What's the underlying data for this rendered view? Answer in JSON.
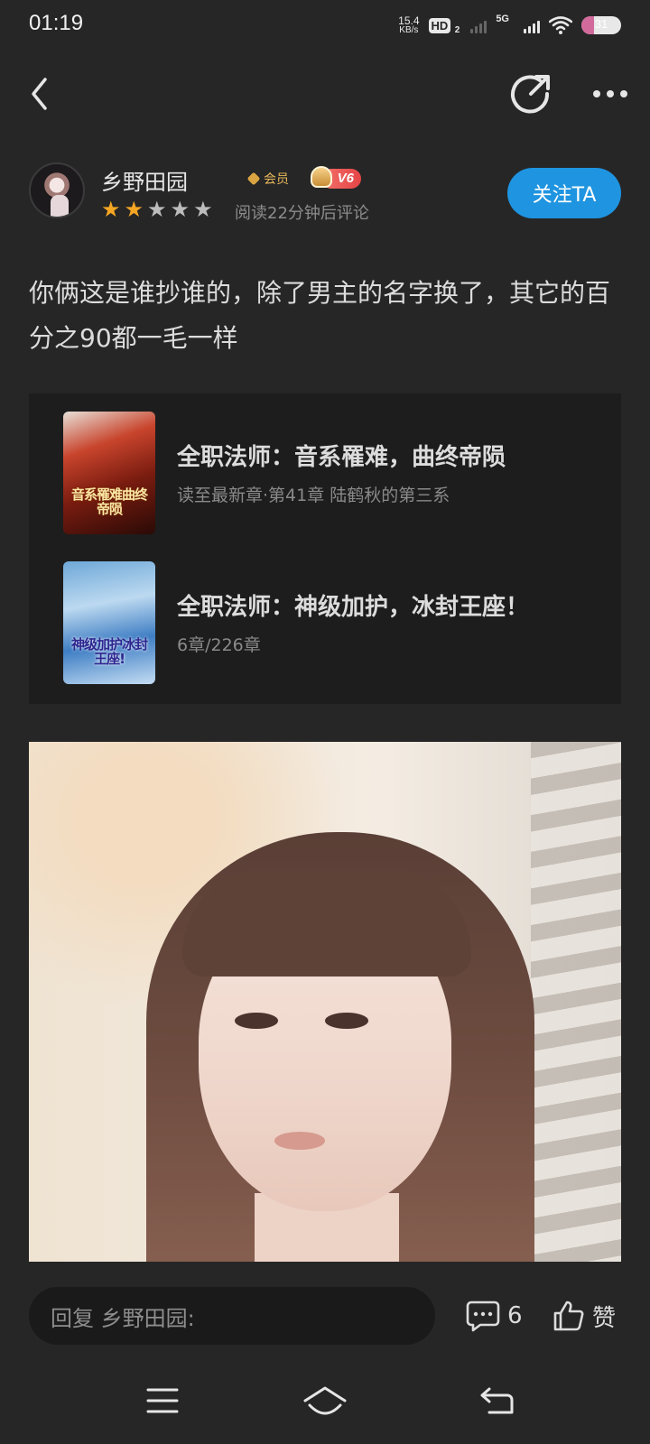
{
  "status_bar": {
    "time": "01:19",
    "net_speed_value": "15.4",
    "net_speed_unit": "KB/s",
    "hd_label": "HD",
    "hd_sub": "2",
    "network_type": "5G",
    "battery_level": "31"
  },
  "author": {
    "name": "乡野田园",
    "vip_label": "会员",
    "level": "V6",
    "rating": 2,
    "rating_max": 5,
    "rating_note": "阅读22分钟后评论",
    "follow_label": "关注TA"
  },
  "comment": {
    "text": "你俩这是谁抄谁的，除了男主的名字换了，其它的百分之90都一毛一样"
  },
  "books": [
    {
      "title": "全职法师：音系罹难，曲终帝陨",
      "subtitle": "读至最新章·第41章 陆鹤秋的第三系",
      "cover_text": "音系罹难曲终帝陨"
    },
    {
      "title": "全职法师：神级加护，冰封王座！",
      "subtitle": "6章/226章",
      "cover_text": "神级加护冰封王座!"
    }
  ],
  "bottom_bar": {
    "reply_placeholder": "回复 乡野田园:",
    "comment_count": "6",
    "like_label": "赞"
  },
  "colors": {
    "background": "#262626",
    "accent": "#1f94e0",
    "star_on": "#f5a623",
    "star_off": "#bcbcbc"
  }
}
